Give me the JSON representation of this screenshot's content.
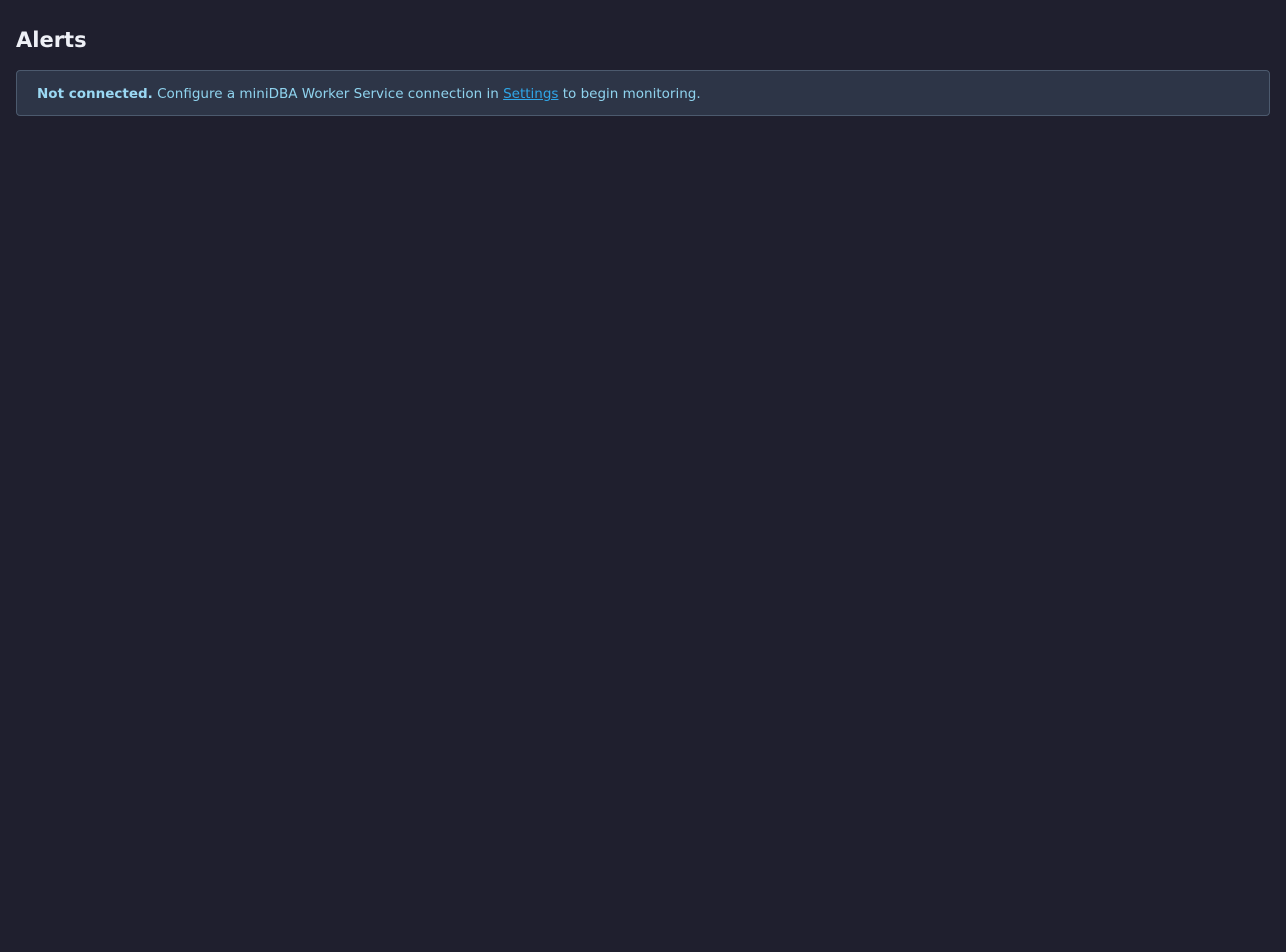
{
  "page": {
    "title": "Alerts"
  },
  "banner": {
    "status_label": "Not connected.",
    "message_before_link": "Configure a miniDBA Worker Service connection in",
    "link_label": "Settings",
    "message_after_link": "to begin monitoring."
  },
  "colors": {
    "background": "#1f1f2e",
    "banner_background": "#2d3547",
    "banner_border": "#4c5a6e",
    "banner_text": "#8fd3ee",
    "link": "#2fa6e8"
  }
}
